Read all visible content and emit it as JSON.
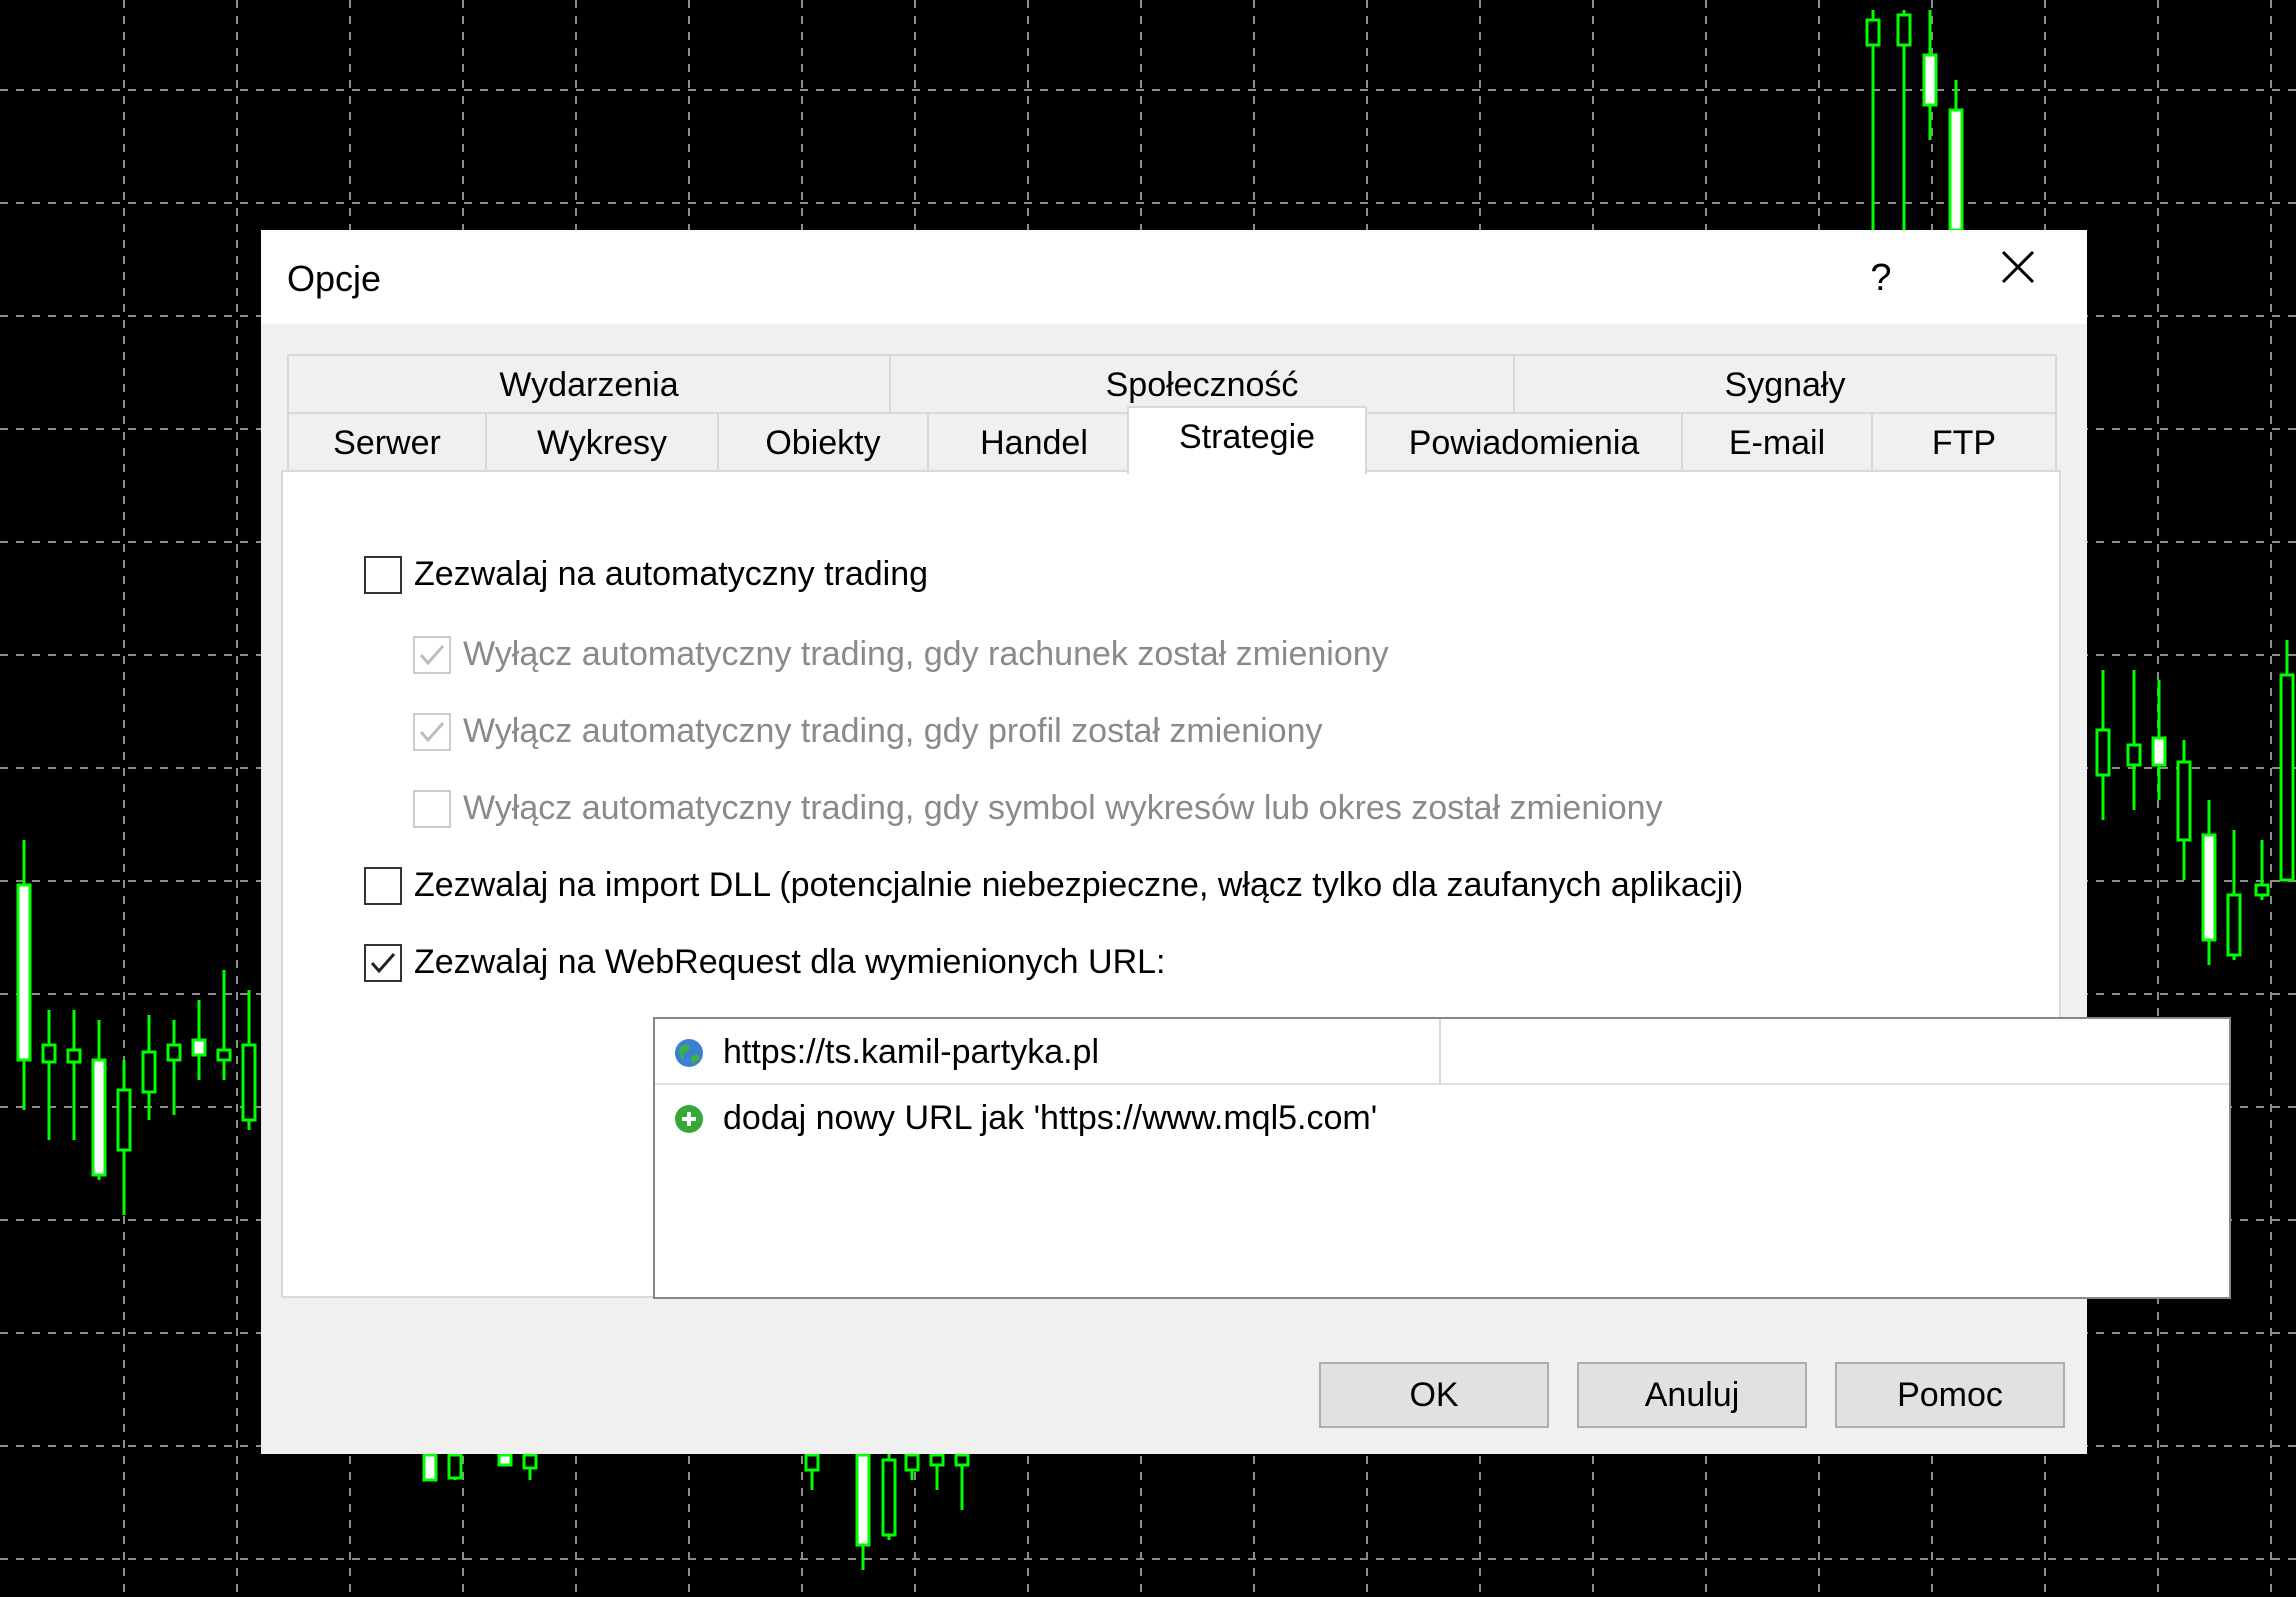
{
  "dialog": {
    "title": "Opcje",
    "help_label": "?"
  },
  "tabs": {
    "row1": [
      {
        "label": "Wydarzenia"
      },
      {
        "label": "Społeczność"
      },
      {
        "label": "Sygnały"
      }
    ],
    "row2": [
      {
        "label": "Serwer"
      },
      {
        "label": "Wykresy"
      },
      {
        "label": "Obiekty"
      },
      {
        "label": "Handel"
      },
      {
        "label": "Strategie",
        "active": true
      },
      {
        "label": "Powiadomienia"
      },
      {
        "label": "E-mail"
      },
      {
        "label": "FTP"
      }
    ]
  },
  "options": {
    "auto_trading": {
      "label": "Zezwalaj na automatyczny trading",
      "checked": false
    },
    "disable_on_account": {
      "label": "Wyłącz automatyczny trading, gdy rachunek został zmieniony",
      "checked": true,
      "disabled": true
    },
    "disable_on_profile": {
      "label": "Wyłącz automatyczny trading, gdy profil został zmieniony",
      "checked": true,
      "disabled": true
    },
    "disable_on_symbol": {
      "label": "Wyłącz automatyczny trading, gdy symbol wykresów lub okres został zmieniony",
      "checked": false,
      "disabled": true
    },
    "dll_import": {
      "label": "Zezwalaj na import DLL (potencjalnie niebezpieczne, włącz tylko dla zaufanych aplikacji)",
      "checked": false
    },
    "webrequest": {
      "label": "Zezwalaj na WebRequest dla wymienionych URL:",
      "checked": true
    }
  },
  "url_list": {
    "items": [
      {
        "url": "https://ts.kamil-partyka.pl",
        "icon": "globe-icon"
      }
    ],
    "add_hint": "dodaj nowy URL jak 'https://www.mql5.com'",
    "add_icon": "plus-circle-icon"
  },
  "buttons": {
    "ok": "OK",
    "cancel": "Anuluj",
    "help": "Pomoc"
  },
  "colors": {
    "chart_bg": "#000000",
    "grid": "#8c8c8c",
    "candle": "#00ff00",
    "dialog_bg": "#f0f0f0",
    "panel_bg": "#ffffff"
  }
}
